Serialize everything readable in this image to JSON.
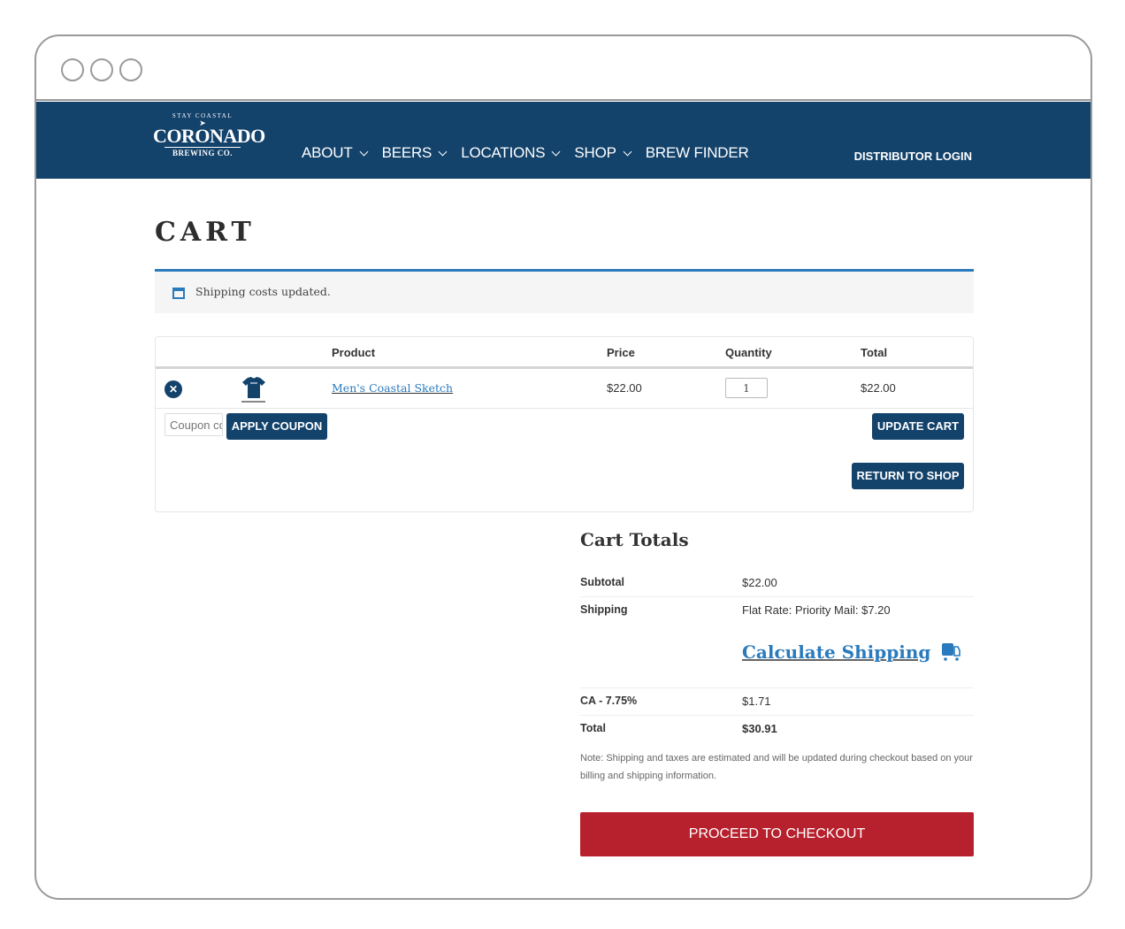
{
  "window": {
    "controls": [
      "close",
      "minimize",
      "maximize"
    ]
  },
  "header": {
    "logo": {
      "tagline": "STAY COASTAL",
      "name": "CORONADO",
      "subtitle": "BREWING CO."
    },
    "nav": [
      {
        "label": "ABOUT",
        "has_dropdown": true
      },
      {
        "label": "BEERS",
        "has_dropdown": true
      },
      {
        "label": "LOCATIONS",
        "has_dropdown": true
      },
      {
        "label": "SHOP",
        "has_dropdown": true
      },
      {
        "label": "BREW FINDER",
        "has_dropdown": false
      }
    ],
    "distributor_login": "DISTRIBUTOR LOGIN",
    "brand_color": "#13426b"
  },
  "page": {
    "title": "CART"
  },
  "notice": {
    "icon": "window-icon",
    "text": "Shipping costs updated.",
    "accent_color": "#2a7bbd"
  },
  "cart_table": {
    "columns": [
      "",
      "",
      "Product",
      "Price",
      "Quantity",
      "Total"
    ],
    "rows": [
      {
        "remove_icon": "close-circle-icon",
        "thumbnail": "t-shirt",
        "product": "Men's Coastal Sketch",
        "price": "$22.00",
        "quantity": "1",
        "total": "$22.00"
      }
    ],
    "coupon_placeholder": "Coupon code",
    "apply_coupon": "APPLY COUPON",
    "update_cart": "UPDATE CART",
    "return_to_shop": "RETURN TO SHOP"
  },
  "cart_totals": {
    "title": "Cart Totals",
    "subtotal_label": "Subtotal",
    "subtotal_value": "$22.00",
    "shipping_label": "Shipping",
    "shipping_value": "Flat Rate: Priority Mail: $7.20",
    "calculate_shipping": "Calculate Shipping",
    "tax_label": "CA - 7.75%",
    "tax_value": "$1.71",
    "total_label": "Total",
    "total_value": "$30.91",
    "note": "Note: Shipping and taxes are estimated and will be updated during checkout based on your billing and shipping information.",
    "checkout_button": "PROCEED TO CHECKOUT",
    "checkout_color": "#b7212d"
  }
}
